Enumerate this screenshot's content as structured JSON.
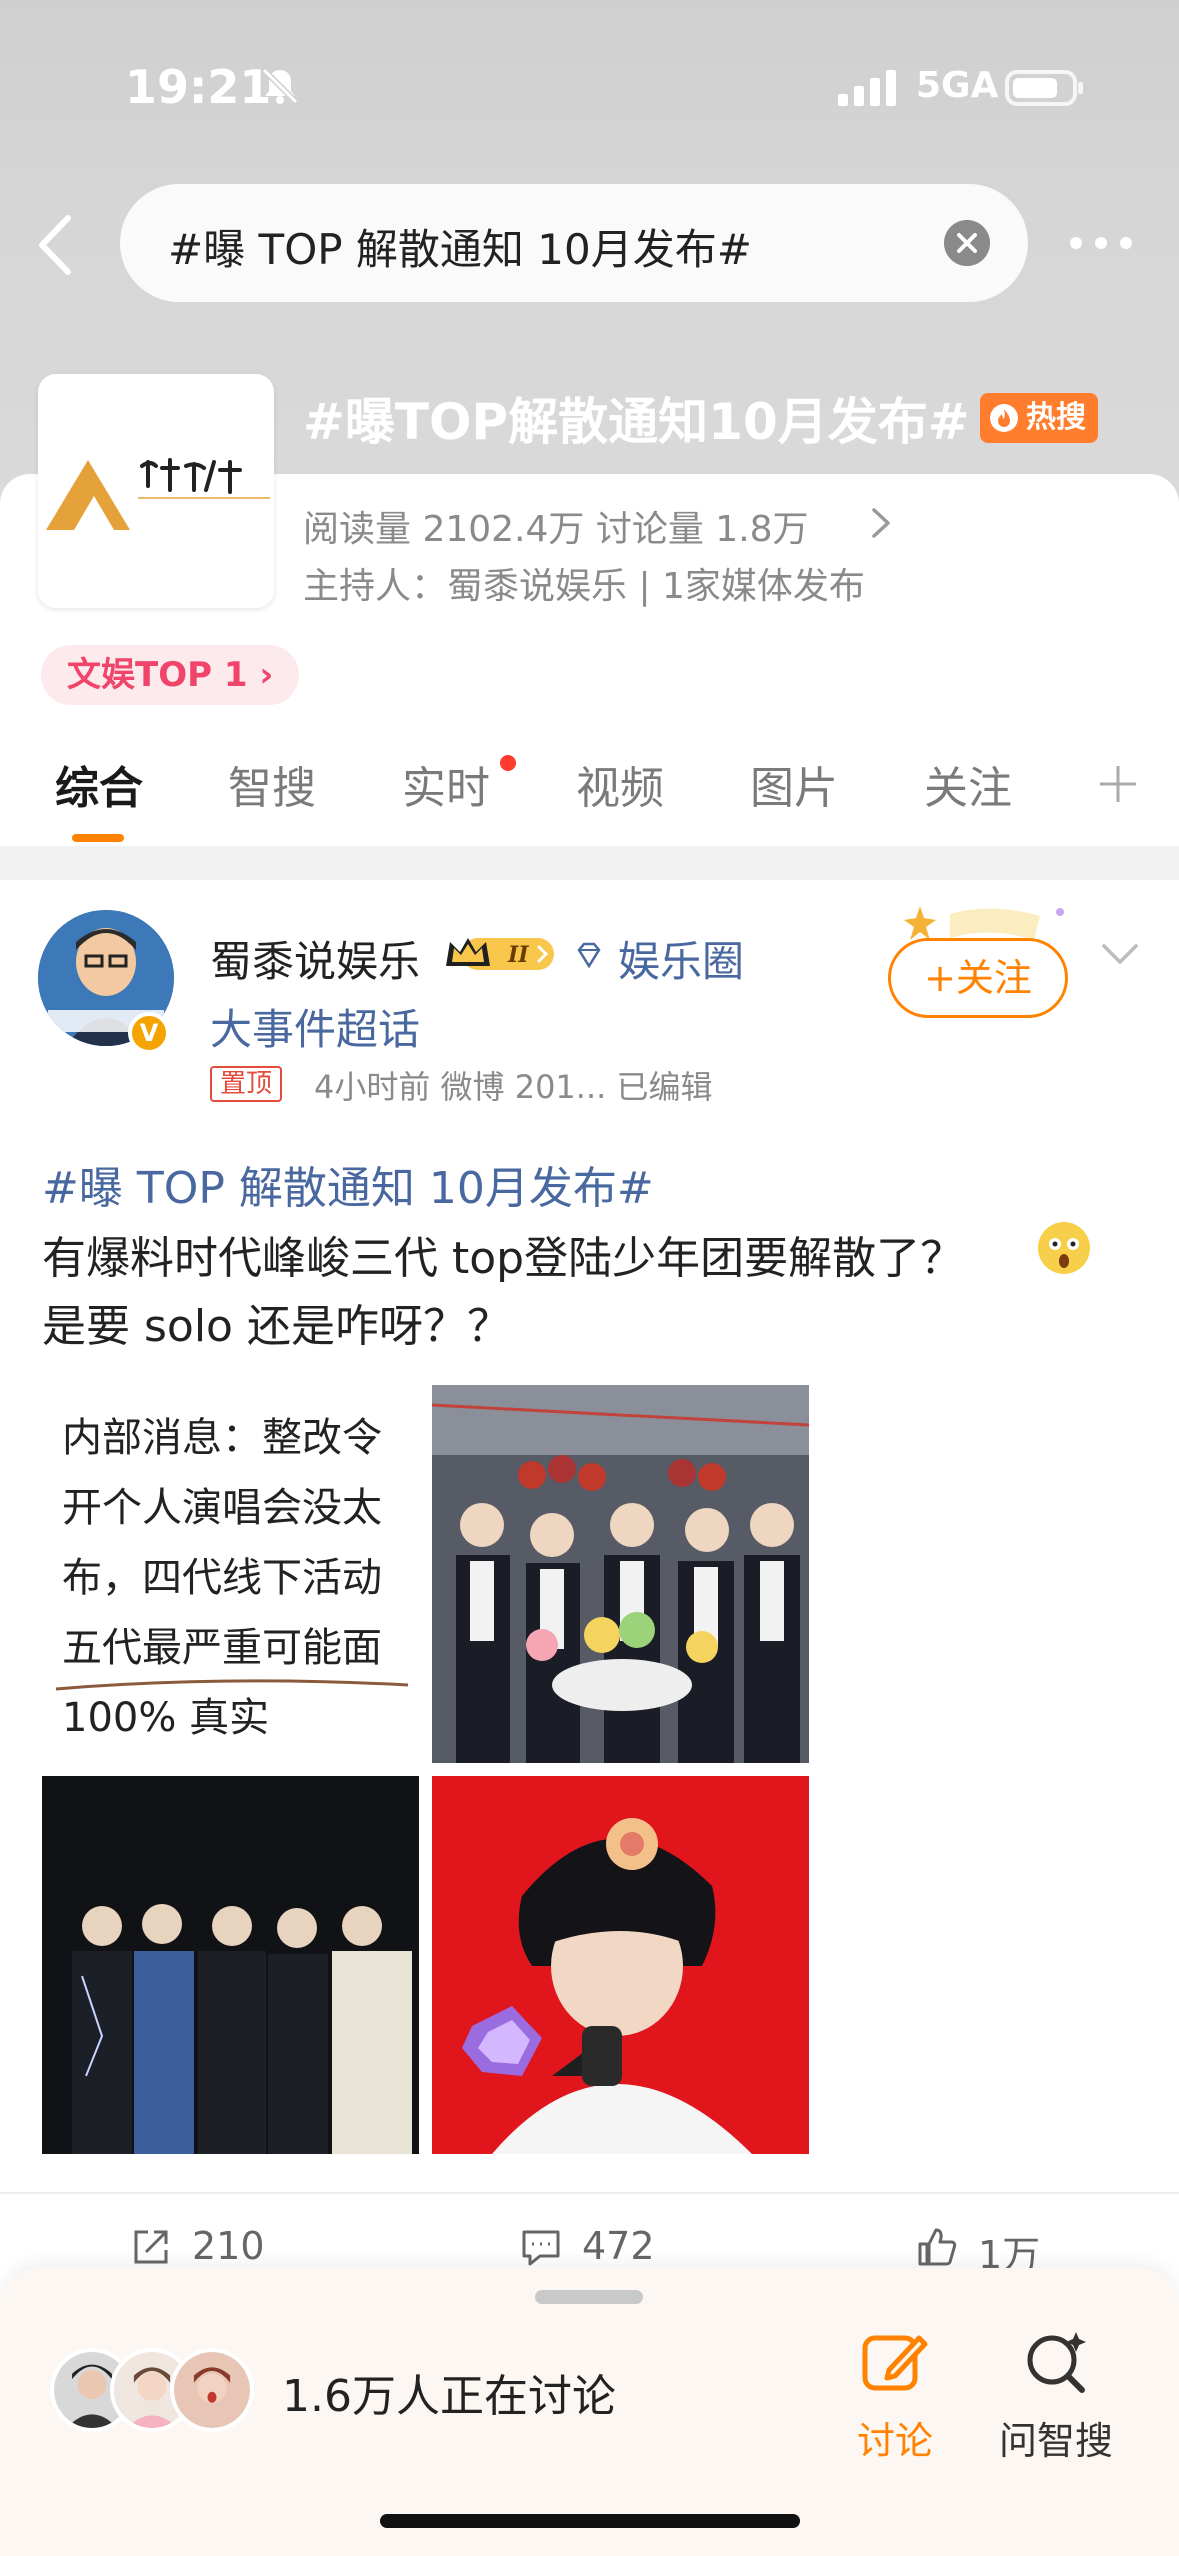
{
  "status_bar": {
    "time": "19:21",
    "network": "5GA"
  },
  "search": {
    "query": "#曝 TOP 解散通知 10月发布#"
  },
  "topic": {
    "title": "#曝TOP解散通知10月发布#",
    "hot_label": "热搜",
    "stats": "阅读量 2102.4万  讨论量 1.8万",
    "host": "主持人：蜀黍说娱乐 | 1家媒体发布",
    "rank": "文娱TOP 1 ›"
  },
  "tabs": [
    {
      "label": "综合",
      "active": true
    },
    {
      "label": "智搜"
    },
    {
      "label": "实时",
      "dot": true
    },
    {
      "label": "视频"
    },
    {
      "label": "图片"
    },
    {
      "label": "关注"
    }
  ],
  "post": {
    "username": "蜀黍说娱乐",
    "level": "II",
    "circle_part1": "娱乐圈",
    "circle_part2": "大事件超话",
    "pin": "置顶",
    "meta": "4小时前  微博 201...  已编辑",
    "follow": "+关注",
    "hashtag": "#曝 TOP 解散通知 10月发布#",
    "line1": "有爆料时代峰峻三代 top登陆少年团要解散了？",
    "line2": "是要 solo 还是咋呀？？",
    "memo_lines": [
      "内部消息：整改令",
      "开个人演唱会没太",
      "布，四代线下活动",
      "五代最严重可能面",
      "100% 真实"
    ],
    "repost_count": "210",
    "comment_count": "472",
    "like_count": "1万"
  },
  "discuss_bar": {
    "count_text": "1.6万人正在讨论",
    "discuss_label": "讨论",
    "ask_label": "问智搜"
  },
  "colors": {
    "accent": "#ff8200",
    "link": "#4a68a0",
    "hot": "#ff7d2c"
  }
}
